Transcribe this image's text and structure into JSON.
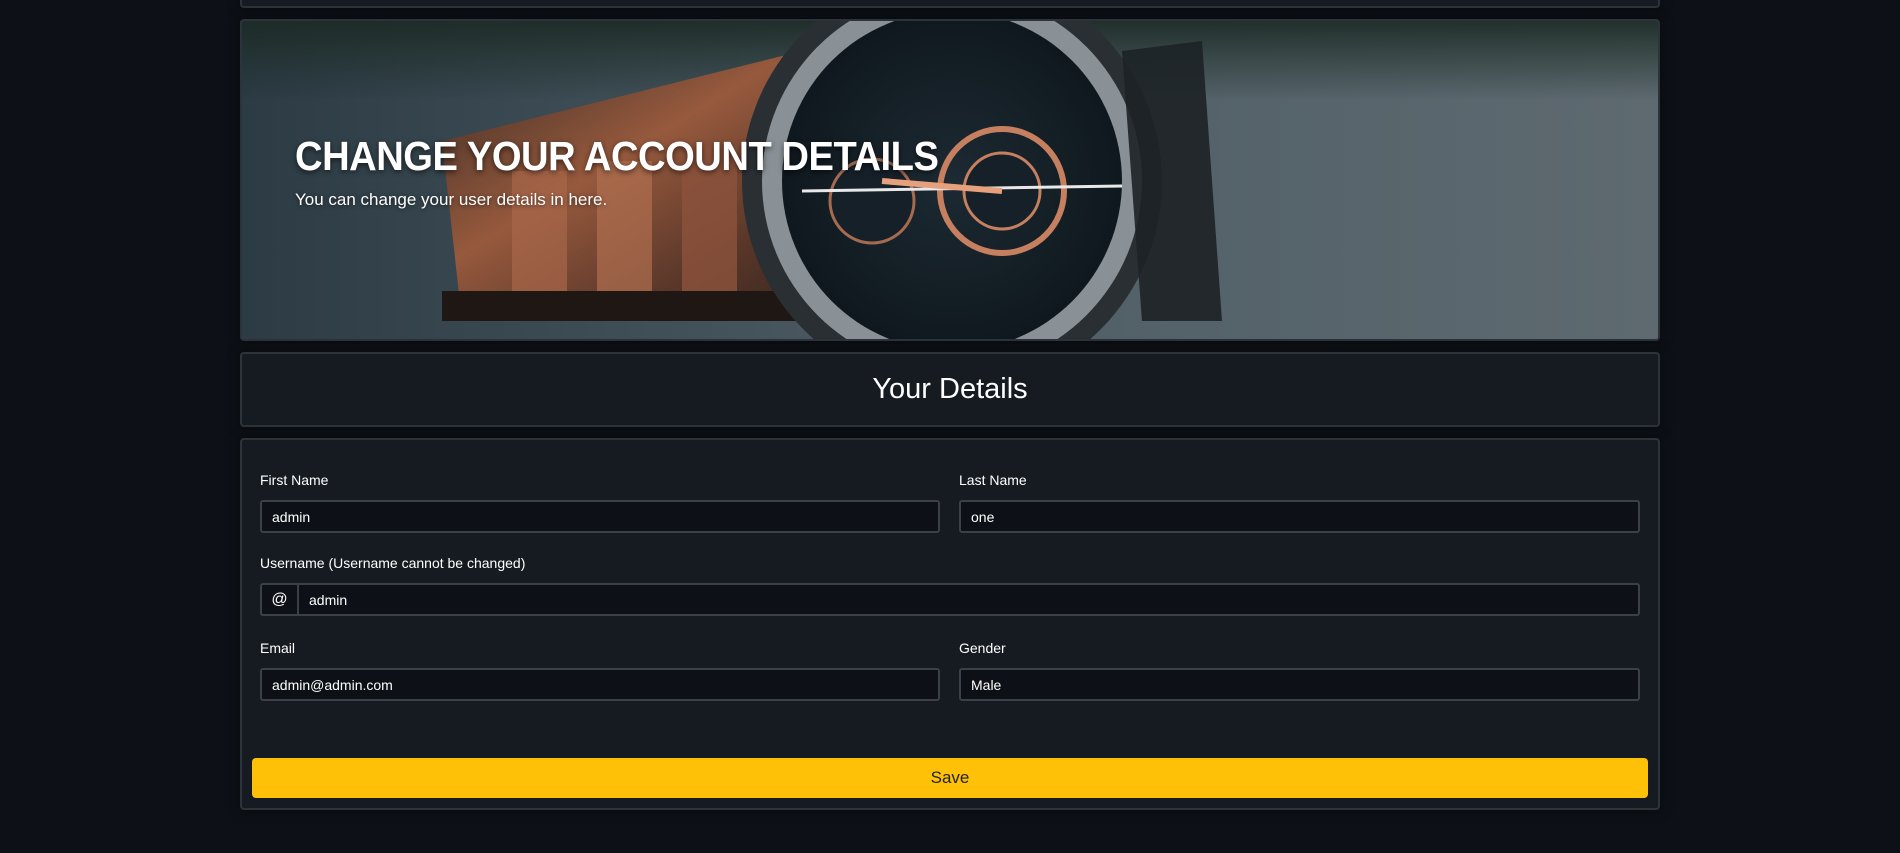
{
  "hero": {
    "title": "CHANGE YOUR ACCOUNT DETAILS",
    "subtitle": "You can change your user details in here.",
    "image": "wristwatch-photo"
  },
  "details": {
    "title": "Your Details"
  },
  "form": {
    "first_name": {
      "label": "First Name",
      "value": "admin"
    },
    "last_name": {
      "label": "Last Name",
      "value": "one"
    },
    "username": {
      "label": "Username (Username cannot be changed)",
      "prefix": "@",
      "value": "admin"
    },
    "email": {
      "label": "Email",
      "value": "admin@admin.com"
    },
    "gender": {
      "label": "Gender",
      "value": "Male"
    },
    "save_label": "Save"
  },
  "colors": {
    "background": "#0d1117",
    "card": "#161b22",
    "accent": "#ffc107"
  }
}
